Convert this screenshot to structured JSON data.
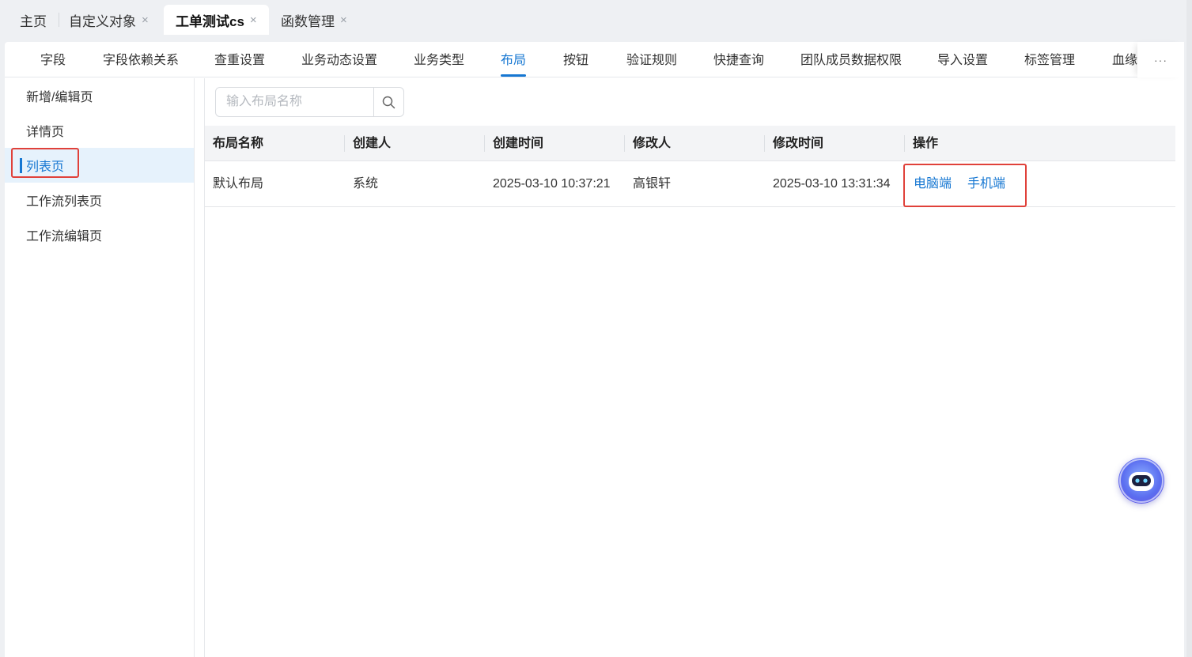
{
  "top_tabs": [
    {
      "label": "主页"
    },
    {
      "label": "自定义对象"
    },
    {
      "label": "工单测试cs"
    },
    {
      "label": "函数管理"
    }
  ],
  "close_glyph": "×",
  "sub_nav": {
    "items": [
      {
        "label": "字段"
      },
      {
        "label": "字段依赖关系"
      },
      {
        "label": "查重设置"
      },
      {
        "label": "业务动态设置"
      },
      {
        "label": "业务类型"
      },
      {
        "label": "布局"
      },
      {
        "label": "按钮"
      },
      {
        "label": "验证规则"
      },
      {
        "label": "快捷查询"
      },
      {
        "label": "团队成员数据权限"
      },
      {
        "label": "导入设置"
      },
      {
        "label": "标签管理"
      },
      {
        "label": "血缘"
      }
    ],
    "active": "布局",
    "more_glyph": "···"
  },
  "side_menu": {
    "items": [
      {
        "label": "新增/编辑页"
      },
      {
        "label": "详情页"
      },
      {
        "label": "列表页"
      },
      {
        "label": "工作流列表页"
      },
      {
        "label": "工作流编辑页"
      }
    ],
    "active": "列表页"
  },
  "search": {
    "placeholder": "输入布局名称",
    "icon": "search-icon"
  },
  "table": {
    "columns": [
      "布局名称",
      "创建人",
      "创建时间",
      "修改人",
      "修改时间",
      "操作"
    ],
    "rows": [
      {
        "name": "默认布局",
        "creator": "系统",
        "created_at": "2025-03-10 10:37:21",
        "modifier": "高银轩",
        "modified_at": "2025-03-10 13:31:34",
        "actions": [
          "电脑端",
          "手机端"
        ]
      }
    ]
  },
  "assistant": {
    "icon": "robot-assistant-icon"
  },
  "colors": {
    "accent": "#1677d2",
    "highlight_box": "#e0413a",
    "active_bg": "#e6f2fc"
  }
}
